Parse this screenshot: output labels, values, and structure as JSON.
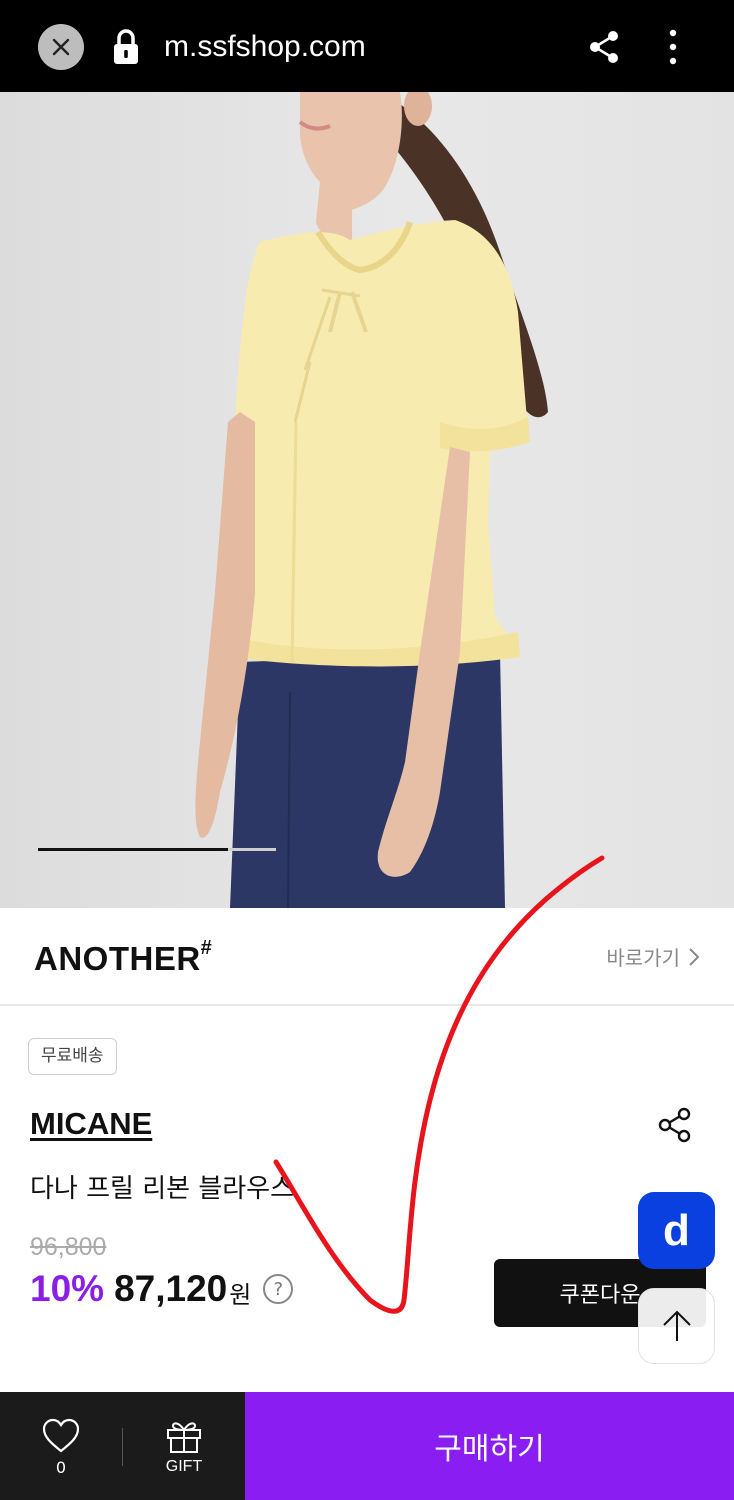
{
  "browser": {
    "url": "m.ssfshop.com"
  },
  "brand_row": {
    "logo": "ANOTHER",
    "logo_mark": "#",
    "link_label": "바로가기"
  },
  "product": {
    "shipping_badge": "무료배송",
    "brand": "MICANE",
    "name": "다나 프릴 리본 블라우스",
    "original_price": "96,800",
    "discount": "10%",
    "price": "87,120",
    "currency": "원",
    "help_symbol": "?",
    "image_slider_progress": 0.8
  },
  "actions": {
    "coupon_label": "쿠폰다운",
    "floating_app_label": "d",
    "like_count": "0",
    "gift_label": "GIFT",
    "buy_label": "구매하기"
  },
  "colors": {
    "accent_purple": "#8a1ef2",
    "discount_purple": "#8b1ee6",
    "floating_blue": "#0a3fe0",
    "annotation_red": "#e8141c"
  },
  "icons": [
    "close-icon",
    "lock-icon",
    "share-icon",
    "more-vertical-icon",
    "chevron-right-icon",
    "help-icon",
    "arrow-up-icon",
    "heart-icon",
    "gift-icon"
  ]
}
